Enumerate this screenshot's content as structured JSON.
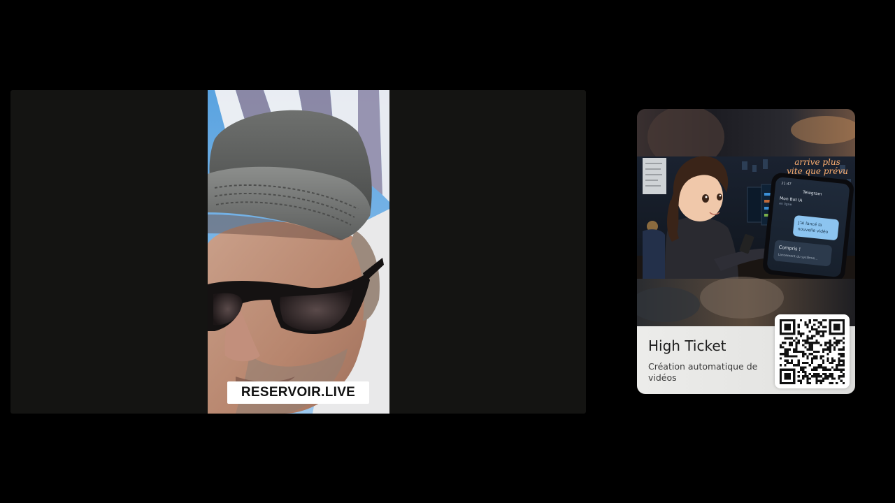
{
  "stream": {
    "watermark": "RESERVOIR.LIVE"
  },
  "promo_card": {
    "title": "High Ticket",
    "subtitle": "Création automatique de vidéos",
    "neon_sign": "arrive plus vite que prévu",
    "phone_chat": {
      "time": "21:47",
      "app": "Telegram",
      "contact": "Mon Bot IA",
      "status": "en ligne",
      "sent_message": "J'ai lancé la nouvelle vidéo",
      "reply": "Compris !",
      "reply_detail": "Lancement du système..."
    }
  },
  "colors": {
    "page_background": "#000000",
    "player_background": "#141412",
    "watermark_background": "#ffffff",
    "card_footer": "#ececea"
  }
}
